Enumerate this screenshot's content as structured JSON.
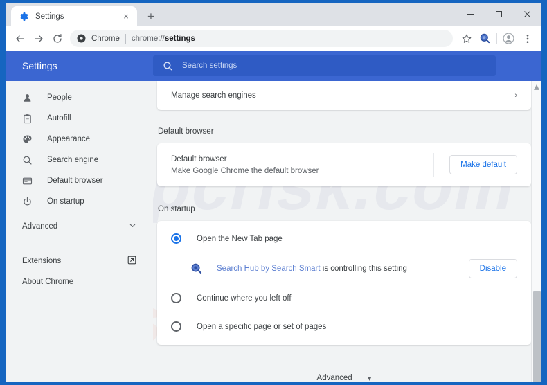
{
  "window": {
    "controls": {
      "minimize": "minimize-icon",
      "maximize": "maximize-icon",
      "close": "close-icon"
    }
  },
  "tabs": [
    {
      "title": "Settings",
      "favicon": "gear-icon",
      "close_label": "×",
      "active": true
    }
  ],
  "new_tab_label": "+",
  "toolbar": {
    "back": "back-arrow-icon",
    "forward": "forward-arrow-icon",
    "reload": "reload-icon",
    "omnibox": {
      "site_icon": "chrome-page-icon",
      "chip": "Chrome",
      "url_prefix": "chrome://",
      "url_bold": "settings"
    },
    "bookmark": "star-icon",
    "extension": "search-hub-extension-icon",
    "profile": "avatar-icon",
    "menu": "three-dot-menu-icon"
  },
  "settings_header": {
    "title": "Settings",
    "search_placeholder": "Search settings",
    "search_icon": "search-icon",
    "bg_color": "#3B66D1"
  },
  "sidebar": {
    "items": [
      {
        "label": "People",
        "icon": "person-icon"
      },
      {
        "label": "Autofill",
        "icon": "clipboard-icon"
      },
      {
        "label": "Appearance",
        "icon": "palette-icon"
      },
      {
        "label": "Search engine",
        "icon": "search-icon"
      },
      {
        "label": "Default browser",
        "icon": "browser-window-icon"
      },
      {
        "label": "On startup",
        "icon": "power-icon"
      }
    ],
    "advanced": {
      "label": "Advanced",
      "icon": "chevron-down-icon"
    },
    "footer": [
      {
        "label": "Extensions",
        "icon": "external-link-icon"
      },
      {
        "label": "About Chrome",
        "icon": ""
      }
    ]
  },
  "main": {
    "manage_search_engines": {
      "label": "Manage search engines",
      "chevron": "›"
    },
    "default_browser": {
      "section_title": "Default browser",
      "title": "Default browser",
      "subtitle": "Make Google Chrome the default browser",
      "button": "Make default"
    },
    "on_startup": {
      "section_title": "On startup",
      "options": [
        {
          "label": "Open the New Tab page",
          "selected": true
        },
        {
          "label": "Continue where you left off",
          "selected": false
        },
        {
          "label": "Open a specific page or set of pages",
          "selected": false
        }
      ],
      "extension_notice": {
        "icon": "search-hub-extension-icon",
        "link_text": "Search Hub by Search Smart",
        "suffix_text": " is controlling this setting",
        "button": "Disable"
      }
    },
    "advanced_footer": {
      "label": "Advanced",
      "caret": "▾"
    }
  },
  "watermark": {
    "text_a": "pcrisk.com",
    "text_b": "pcrisk.com"
  },
  "scrollbar": {
    "up": "▴",
    "down": "▾"
  },
  "colors": {
    "accent_blue": "#1A73E8",
    "header_blue": "#3B66D1",
    "frame_blue": "#1565C0"
  }
}
